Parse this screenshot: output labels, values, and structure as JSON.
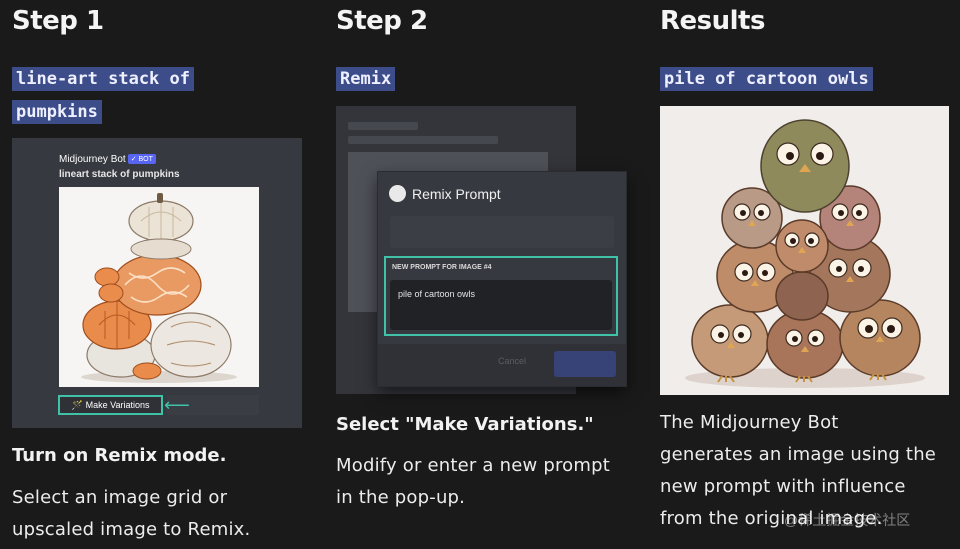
{
  "step1": {
    "title": "Step 1",
    "prompt_line1": "line-art stack of",
    "prompt_line2": "pumpkins",
    "discord": {
      "bot_name": "Midjourney Bot",
      "bot_badge": "✓ BOT",
      "prompt": "lineart stack of pumpkins",
      "button_label": "Make Variations"
    },
    "heading": "Turn on Remix mode.",
    "body_line1": "Select an image grid or",
    "body_line2": "upscaled image to Remix."
  },
  "step2": {
    "title": "Step 2",
    "prompt": "Remix",
    "modal": {
      "title": "Remix Prompt",
      "field_label": "NEW PROMPT FOR IMAGE #4",
      "field_value": "pile of cartoon owls",
      "cancel_label": "Cancel"
    },
    "heading": "Select \"Make Variations.\"",
    "body_line1": "Modify or enter a new prompt",
    "body_line2": "in the pop-up."
  },
  "results": {
    "title": "Results",
    "prompt": "pile of cartoon owls",
    "body_line1": "The Midjourney Bot",
    "body_line2": "generates an image using the",
    "body_line3": "new prompt with influence",
    "body_line4": "from the original image."
  },
  "watermark": "@稀土掘金技术社区",
  "colors": {
    "page_bg": "#1a1a1a",
    "prompt_tag_bg": "#3d4d8a",
    "highlight": "#3fc2a8",
    "discord_bg": "#36393f"
  }
}
